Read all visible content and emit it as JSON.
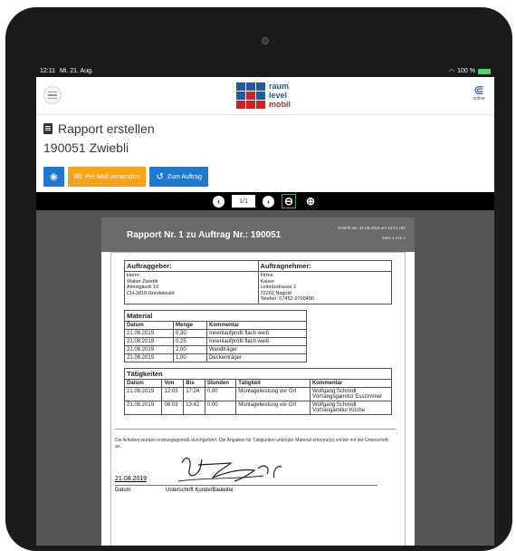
{
  "statusbar": {
    "time": "12:11",
    "date": "Mi. 21. Aug.",
    "battery": "100 %"
  },
  "logo": {
    "line1": "raum",
    "line2": "level",
    "line3": "mobil",
    "colors": [
      "#1f5aa6",
      "#1f5aa6",
      "#d32020"
    ]
  },
  "online": {
    "label": "online"
  },
  "page": {
    "title": "Rapport erstellen",
    "subtitle": "190051 Zwiebli"
  },
  "actions": {
    "mail_label": "Per Mail versenden",
    "order_label": "Zum Auftrag"
  },
  "viewer": {
    "page_value": "1/1"
  },
  "report": {
    "title": "Rapport Nr. 1 zu Auftrag Nr.: 190051",
    "created": "Erstellt am: 21.08.2019 um 12:10 Uhr",
    "pageinfo": "Seite 1 von 1",
    "client_header": "Auftraggeber:",
    "contractor_header": "Auftragnehmer:",
    "client": [
      "Herrn",
      "Walter Zwiebli",
      "Almisgässli 10",
      "CH-3818 Grindelwald"
    ],
    "contractor": [
      "Firma",
      "Kaiser",
      "Leibnizstrasse 2",
      "72202 Nagold",
      "Telefon: 07452-9700400"
    ],
    "material": {
      "caption": "Material",
      "headers": [
        "Datum",
        "Menge",
        "Kommentar"
      ],
      "rows": [
        [
          "21.08.2019",
          "0,30",
          "Innenlaufprofil flach weiß"
        ],
        [
          "21.08.2019",
          "0,25",
          "Innenlaufprofil flach weiß"
        ],
        [
          "21.08.2019",
          "2,00",
          "Wandträger"
        ],
        [
          "21.08.2019",
          "1,00",
          "Deckenträger"
        ]
      ]
    },
    "tasks": {
      "caption": "Tätigkeiten",
      "headers": [
        "Datum",
        "Von",
        "Bis",
        "Stunden",
        "Tätigkeit",
        "Kommentar"
      ],
      "rows": [
        [
          "21.08.2019",
          "12:03",
          "17:24",
          "0,00",
          "Montageleistung vor Ort",
          "Wolfgang Schmidt Vorhangsgarnitur Esszimmer"
        ],
        [
          "21.08.2019",
          "08:03",
          "13:42",
          "0,00",
          "Montageleistung vor Ort",
          "Wolfgang Schmidt Vorhangarnitur Küche"
        ]
      ]
    },
    "note": "Die Arbeiten wurden ordnungsgemäß durchgeführt. Die Angaben für Tätigkeiten und/oder Material erkenne(n) ich/wir mit der Unterschrift an.",
    "sign_date": "21.08.2019",
    "sign_label_date": "Datum",
    "sign_label_sig": "Unterschrift Kunde/Bauleiter"
  }
}
